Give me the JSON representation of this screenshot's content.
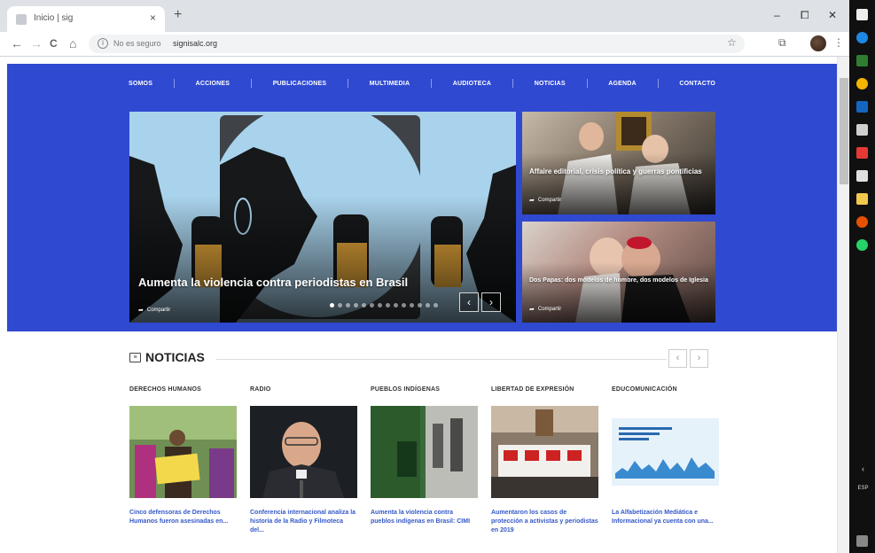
{
  "browser": {
    "tab_title": "Inicio | sig",
    "tab_close": "×",
    "new_tab": "+",
    "window_controls": [
      "–",
      "⧠",
      "✕"
    ],
    "nav": {
      "back": "←",
      "forward": "→",
      "reload": "C",
      "home": "⌂"
    },
    "security_text": "No es seguro",
    "url": "signisalc.org",
    "toolbar_icons": {
      "star": "☆",
      "extension": "⧉",
      "menu": "⋮"
    }
  },
  "site": {
    "nav": [
      "SOMOS",
      "ACCIONES",
      "PUBLICACIONES",
      "MULTIMEDIA",
      "AUDIOTECA",
      "NOTICIAS",
      "AGENDA",
      "CONTACTO"
    ],
    "hero": {
      "main_title": "Aumenta la violencia contra periodistas en Brasil",
      "share_label": "Compartir",
      "dot_count": 14,
      "active_dot": 0,
      "prev": "‹",
      "next": "›",
      "side": [
        {
          "title": "Affaire editorial, crisis política y guerras pontificias",
          "share_label": "Compartir"
        },
        {
          "title": "Dos Papas: dos modelos de hombre, dos modelos de Iglesia",
          "share_label": "Compartir"
        }
      ]
    },
    "news": {
      "heading": "NOTICIAS",
      "prev": "‹",
      "next": "›",
      "cards": [
        {
          "category": "DERECHOS HUMANOS",
          "title": "Cinco defensoras de Derechos Humanos fueron asesinadas en..."
        },
        {
          "category": "RADIO",
          "title": "Conferencia internacional analiza la historia de la Radio y Filmoteca del..."
        },
        {
          "category": "PUEBLOS INDÍGENAS",
          "title": "Aumenta la violencia contra pueblos indígenas en Brasil: CIMI"
        },
        {
          "category": "LIBERTAD DE EXPRESIÓN",
          "title": "Aumentaron los casos de protección a activistas y periodistas en 2019"
        },
        {
          "category": "EDUCOMUNICACIÓN",
          "title": "La Alfabetización Mediática e Informacional ya cuenta con una..."
        }
      ]
    }
  },
  "taskbar": {
    "lang": "ESP"
  },
  "colors": {
    "brand_blue": "#2f49d1",
    "link_blue": "#3559c8"
  }
}
